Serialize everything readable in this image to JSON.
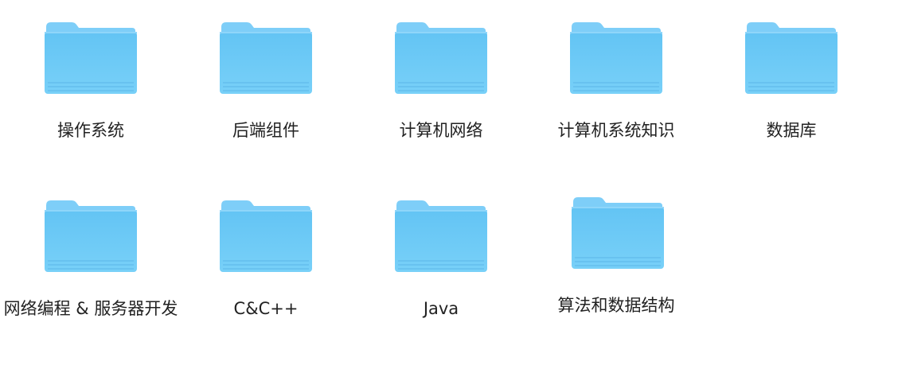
{
  "colors": {
    "folder_tab": "#7ccdf8",
    "folder_body": "#5fc0f2",
    "folder_body_bottom": "#74cdf7",
    "folder_edge": "#4aa9e0",
    "label_text": "#222222"
  },
  "folders": [
    {
      "label": "操作系统",
      "icon": "folder-icon"
    },
    {
      "label": "后端组件",
      "icon": "folder-icon"
    },
    {
      "label": "计算机网络",
      "icon": "folder-icon"
    },
    {
      "label": "计算机系统知识",
      "icon": "folder-icon"
    },
    {
      "label": "数据库",
      "icon": "folder-icon"
    },
    {
      "label": "网络编程 & 服务器开发",
      "icon": "folder-icon"
    },
    {
      "label": "C&C++",
      "icon": "folder-icon"
    },
    {
      "label": "Java",
      "icon": "folder-icon"
    },
    {
      "label": "算法和数据结构",
      "icon": "folder-icon"
    }
  ]
}
